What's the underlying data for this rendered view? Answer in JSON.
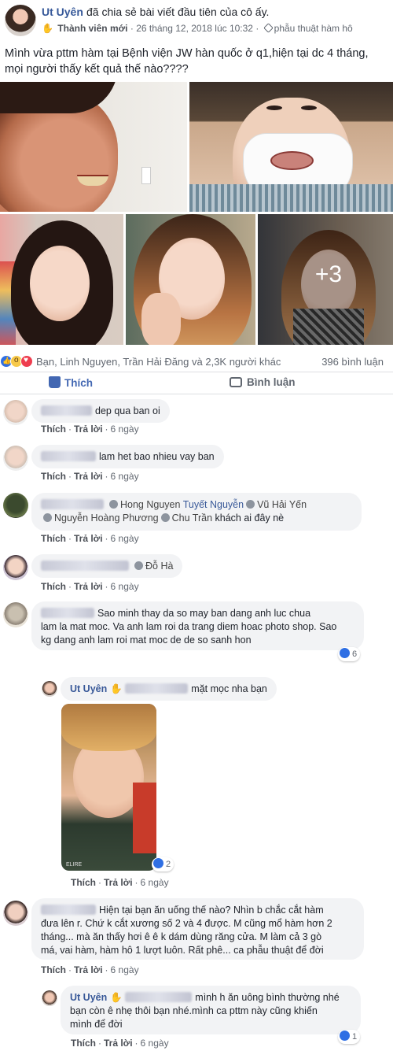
{
  "post": {
    "author": "Ut Uyên",
    "action": "đã chia sẻ bài viết đầu tiên của cô ấy.",
    "member_badge": "Thành viên mới",
    "timestamp": "· 26 tháng 12, 2018 lúc 10:32 ·",
    "tag": "phẫu thuật hàm hô",
    "text": "Mình vừa pttm hàm tại Bệnh viện JW hàn quốc ở q1,hiện tại dc 4 tháng, mọi người thấy kết quả thế nào????",
    "more_photos": "+3",
    "photo_stamp": "10"
  },
  "reactions": {
    "names": "Bạn, Linh Nguyen, Trần Hải Đăng và 2,3K người khác",
    "comment_count": "396 bình luận"
  },
  "actions": {
    "like": "Thích",
    "comment": "Bình luận"
  },
  "comment_footer": {
    "like": "Thích",
    "reply": "Trả lời",
    "age": "6 ngày"
  },
  "comments": [
    {
      "text": "dep qua ban oi"
    },
    {
      "text": "lam het bao nhieu vay ban"
    },
    {
      "mentions": [
        "Hong Nguyen",
        "Tuyết Nguyễn",
        "Vũ Hải Yến",
        "Nguyễn Hoàng Phương",
        "Chu Trần"
      ],
      "text": "khách ai đây nè"
    },
    {
      "mentions": [
        "Đỗ Hà"
      ]
    },
    {
      "text_line1": "Sao minh thay da so may ban dang anh luc chua",
      "text_line2": "lam la mat moc. Va anh lam roi da trang diem hoac photo shop. Sao",
      "text_line3": "kg dang anh lam roi mat moc de de so sanh hon",
      "reactions": "6",
      "reply": {
        "author": "Ut Uyên",
        "text": "mặt mọc nha bạn",
        "photo_brand": "ELIRE",
        "reactions": "2"
      }
    },
    {
      "text_line1": "Hiện tại bạn ăn uống thế nào? Nhìn b chắc cắt hàm",
      "text_line2": "đưa lên r. Chứ k cắt xương số 2 và 4 được. M cũng mổ hàm hơn 2",
      "text_line3": "tháng... mà ăn thấy hơi ê ê k dám dùng răng cửa. M làm cả 3 gò",
      "text_line4": "má, vai hàm, hàm hô 1 lượt luôn. Rất phê... ca phẫu thuật để đời",
      "reply": {
        "author": "Ut Uyên",
        "text_line1": "mình h ăn uông bình thường nhé",
        "text_line2": "bạn còn ê nhẹ thôi bạn nhé.mình ca pttm này cũng khiến",
        "text_line3": "mình để đời",
        "reactions": "1"
      }
    }
  ]
}
